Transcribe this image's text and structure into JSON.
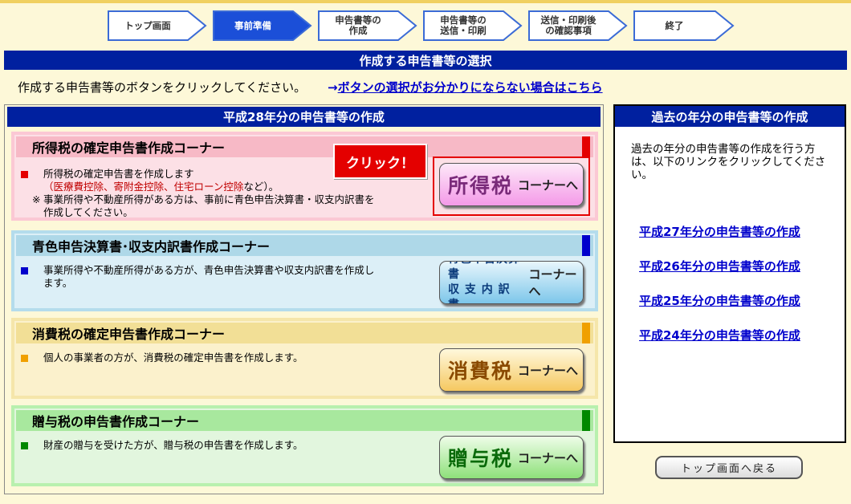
{
  "steps": [
    {
      "label": "トップ画面",
      "active": false
    },
    {
      "label": "事前準備",
      "active": true
    },
    {
      "label": "申告書等の\n作成",
      "active": false
    },
    {
      "label": "申告書等の\n送信・印刷",
      "active": false
    },
    {
      "label": "送信・印刷後\nの確認事項",
      "active": false
    },
    {
      "label": "終了",
      "active": false
    }
  ],
  "page_title": "作成する申告書等の選択",
  "instruction": "作成する申告書等のボタンをクリックしてください。",
  "instruction_link_arrow": "→",
  "instruction_link": "ボタンの選択がお分かりにならない場合はこちら",
  "left_panel": {
    "header": "平成28年分の申告書等の作成",
    "click_badge": "クリック！",
    "corners": [
      {
        "title": "所得税の確定申告書作成コーナー",
        "desc1": "所得税の確定申告書を作成します",
        "desc1_open": "（",
        "desc1_highlight": "医療費控除、寄附金控除、住宅ローン控除",
        "desc1_close": "など）。",
        "note_mark": "※",
        "note": "事業所得や不動産所得がある方は、事前に青色申告決算書・収支内訳書を作成してください。",
        "button_big": "所得税",
        "button_small": "コーナーへ",
        "accent": "#e40000",
        "bg": "#fce0e6",
        "head_bg": "#f7b9c6"
      },
      {
        "title": "青色申告決算書･収支内訳書作成コーナー",
        "desc1": "事業所得や不動産所得がある方が、青色申告決算書や収支内訳書を作成します。",
        "button_line1": "青色申告決算書",
        "button_line2": "収 支 内 訳 書",
        "button_small": "コーナーへ",
        "accent": "#0000cc",
        "bg": "#dceff7",
        "head_bg": "#aed8e8"
      },
      {
        "title": "消費税の確定申告書作成コーナー",
        "desc1": "個人の事業者の方が、消費税の確定申告書を作成します。",
        "button_big": "消費税",
        "button_small": "コーナーへ",
        "accent": "#f0a000",
        "bg": "#fbf1cc",
        "head_bg": "#f2df96"
      },
      {
        "title": "贈与税の申告書作成コーナー",
        "desc1": "財産の贈与を受けた方が、贈与税の申告書を作成します。",
        "button_big": "贈与税",
        "button_small": "コーナーへ",
        "accent": "#008800",
        "bg": "#e2f6de",
        "head_bg": "#a8e89e"
      }
    ]
  },
  "right_panel": {
    "header": "過去の年分の申告書等の作成",
    "text": "過去の年分の申告書等の作成を行う方は、以下のリンクをクリックしてください。",
    "links": [
      "平成27年分の申告書等の作成",
      "平成26年分の申告書等の作成",
      "平成25年分の申告書等の作成",
      "平成24年分の申告書等の作成"
    ]
  },
  "top_button": "トップ画面へ戻る",
  "colors": {
    "navy": "#00209f",
    "link": "#0000cc",
    "background": "#fdf8d8"
  }
}
